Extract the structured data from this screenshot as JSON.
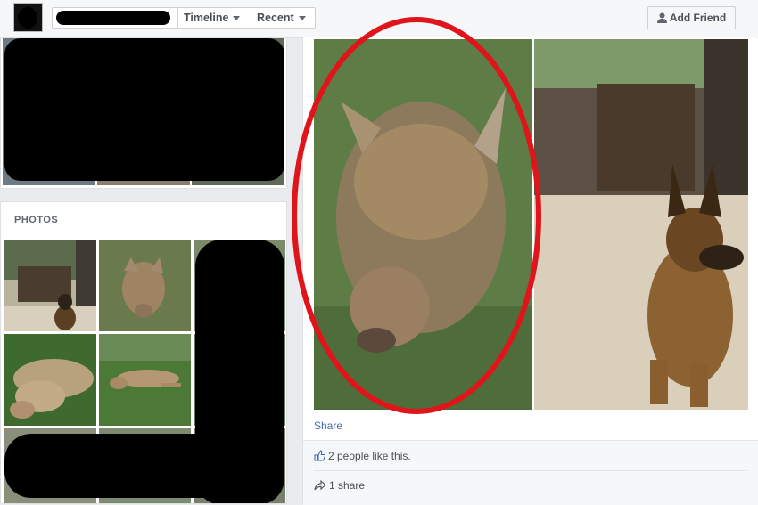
{
  "header": {
    "tabs": [
      {
        "label": "Timeline",
        "icon": "chevron-down-icon"
      },
      {
        "label": "Recent",
        "icon": "chevron-down-icon"
      }
    ],
    "add_friend_label": "Add Friend",
    "add_friend_icon": "person-add-icon"
  },
  "photos_section": {
    "title": "PHOTOS"
  },
  "post": {
    "share_label": "Share",
    "likes_text": "2 people like this.",
    "likes_icon": "thumbs-up-icon",
    "shares_text": "1 share",
    "shares_icon": "share-arrow-icon"
  },
  "colors": {
    "link_blue": "#4267b2",
    "annotation_red": "#e0141b",
    "redaction": "#000000"
  }
}
